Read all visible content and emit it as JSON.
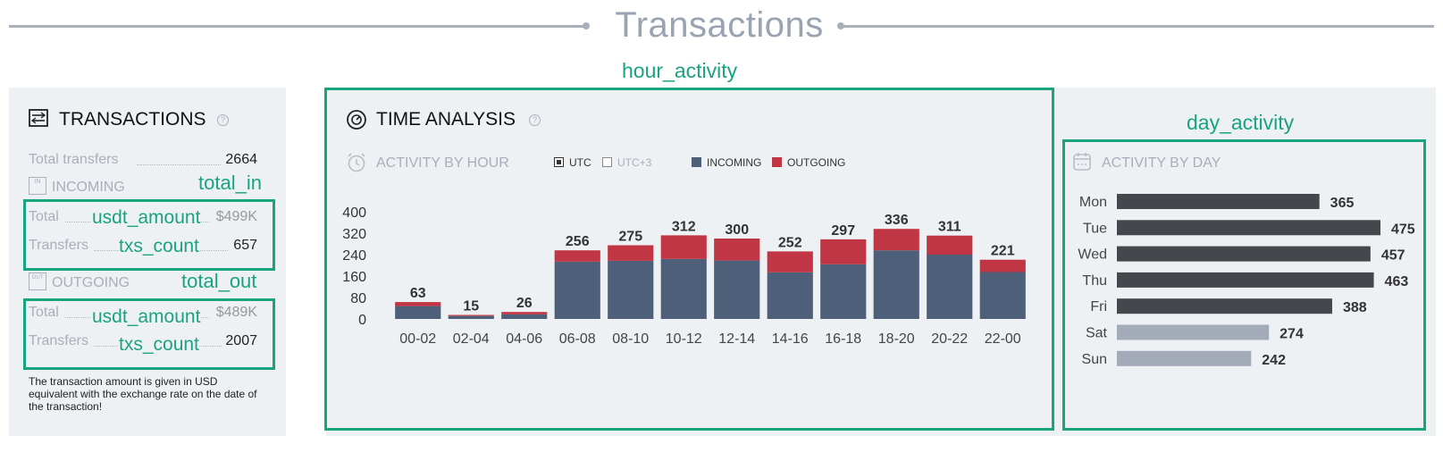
{
  "header": {
    "title": "Transactions"
  },
  "annotations": {
    "hour_activity": "hour_activity",
    "day_activity": "day_activity",
    "total_in": "total_in",
    "total_out": "total_out",
    "in_amount": "usdt_amount",
    "in_count": "txs_count",
    "out_amount": "usdt_amount",
    "out_count": "txs_count"
  },
  "transactions": {
    "title": "TRANSACTIONS",
    "total_transfers_label": "Total transfers",
    "total_transfers_value": "2664",
    "incoming": {
      "label": "INCOMING",
      "icon_text": "IN",
      "total_label": "Total",
      "total_value": "$499K",
      "transfers_label": "Transfers",
      "transfers_value": "657"
    },
    "outgoing": {
      "label": "OUTGOING",
      "icon_text": "OUT",
      "total_label": "Total",
      "total_value": "$489K",
      "transfers_label": "Transfers",
      "transfers_value": "2007"
    },
    "note": "The transaction amount is given in USD equivalent with the exchange rate on the date of the transaction!"
  },
  "time_analysis": {
    "title": "TIME ANALYSIS",
    "subtitle": "ACTIVITY BY HOUR",
    "tz_options": [
      "UTC",
      "UTC+3"
    ],
    "tz_selected": "UTC",
    "legend": [
      "INCOMING",
      "OUTGOING"
    ]
  },
  "day_panel": {
    "subtitle": "ACTIVITY BY DAY"
  },
  "colors": {
    "incoming": "#4e5f7a",
    "outgoing": "#c13644",
    "weekday_bar": "#46474d",
    "weekend_bar": "#a3abb9",
    "annotation": "#1aa37f"
  },
  "chart_data": [
    {
      "type": "bar",
      "stacked": true,
      "title": "ACTIVITY BY HOUR",
      "categories": [
        "00-02",
        "02-04",
        "04-06",
        "06-08",
        "08-10",
        "10-12",
        "12-14",
        "14-16",
        "16-18",
        "18-20",
        "20-22",
        "22-00"
      ],
      "series": [
        {
          "name": "INCOMING",
          "values": [
            48,
            11,
            17,
            214,
            217,
            224,
            218,
            174,
            204,
            256,
            240,
            175
          ]
        },
        {
          "name": "OUTGOING",
          "values": [
            15,
            4,
            9,
            42,
            58,
            88,
            82,
            78,
            93,
            80,
            71,
            46
          ]
        }
      ],
      "totals": [
        63,
        15,
        26,
        256,
        275,
        312,
        300,
        252,
        297,
        336,
        311,
        221
      ],
      "yticks": [
        0,
        80,
        160,
        240,
        320,
        400
      ],
      "ylim": [
        0,
        400
      ],
      "grid": false,
      "legend": "top"
    },
    {
      "type": "bar",
      "orientation": "horizontal",
      "title": "ACTIVITY BY DAY",
      "categories": [
        "Mon",
        "Tue",
        "Wed",
        "Thu",
        "Fri",
        "Sat",
        "Sun"
      ],
      "values": [
        365,
        475,
        457,
        463,
        388,
        274,
        242
      ],
      "weekend": [
        "Sat",
        "Sun"
      ],
      "xlim": [
        0,
        475
      ],
      "grid": false
    }
  ]
}
